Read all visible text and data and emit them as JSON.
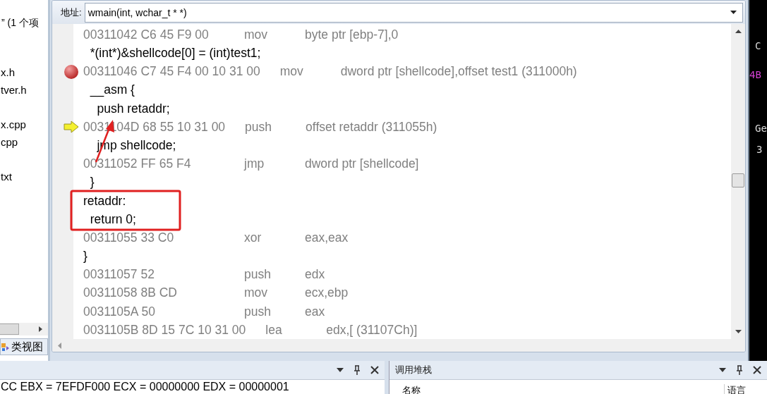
{
  "explorer": {
    "header": "” (1 个项",
    "items": [
      "x.h",
      "tver.h",
      "x.cpp",
      "cpp",
      "txt"
    ],
    "tab": "类视图"
  },
  "address_bar": {
    "label": "地址:",
    "value": "wmain(int, wchar_t * *)"
  },
  "disassembly": [
    {
      "kind": "asm",
      "breakpoint": false,
      "current": false,
      "bytes": "00311042 C6 45 F9 00",
      "mnemonic": "mov",
      "operand": "byte ptr [ebp-7],0"
    },
    {
      "kind": "src",
      "breakpoint": false,
      "current": false,
      "text": "  *(int*)&shellcode[0] = (int)test1;"
    },
    {
      "kind": "asm",
      "breakpoint": true,
      "current": false,
      "bytes": "00311046 C7 45 F4 00 10 31 00",
      "mnemonic": "mov",
      "operand": "dword ptr [shellcode],offset test1 (311000h)"
    },
    {
      "kind": "src",
      "breakpoint": false,
      "current": false,
      "text": "  __asm {"
    },
    {
      "kind": "src",
      "breakpoint": false,
      "current": false,
      "text": "    push retaddr;"
    },
    {
      "kind": "asm",
      "breakpoint": false,
      "current": true,
      "bytes": "0031104D 68 55 10 31 00",
      "mnemonic": "push",
      "operand": "offset retaddr (311055h)"
    },
    {
      "kind": "src",
      "breakpoint": false,
      "current": false,
      "text": "    jmp shellcode;"
    },
    {
      "kind": "asm",
      "breakpoint": false,
      "current": false,
      "bytes": "00311052 FF 65 F4",
      "mnemonic": "jmp",
      "operand": "dword ptr [shellcode]"
    },
    {
      "kind": "src",
      "breakpoint": false,
      "current": false,
      "text": "  }"
    },
    {
      "kind": "src",
      "breakpoint": false,
      "current": false,
      "text": "retaddr:"
    },
    {
      "kind": "src",
      "breakpoint": false,
      "current": false,
      "text": "  return 0;"
    },
    {
      "kind": "asm",
      "breakpoint": false,
      "current": false,
      "bytes": "00311055 33 C0",
      "mnemonic": "xor",
      "operand": "eax,eax"
    },
    {
      "kind": "src",
      "breakpoint": false,
      "current": false,
      "text": "}"
    },
    {
      "kind": "asm",
      "breakpoint": false,
      "current": false,
      "bytes": "00311057 52",
      "mnemonic": "push",
      "operand": "edx"
    },
    {
      "kind": "asm",
      "breakpoint": false,
      "current": false,
      "bytes": "00311058 8B CD",
      "mnemonic": "mov",
      "operand": "ecx,ebp"
    },
    {
      "kind": "asm",
      "breakpoint": false,
      "current": false,
      "bytes": "0031105A 50",
      "mnemonic": "push",
      "operand": "eax"
    },
    {
      "kind": "asm",
      "breakpoint": false,
      "current": false,
      "bytes": "0031105B 8D 15 7C 10 31 00",
      "mnemonic": "lea",
      "operand": "edx,[ (31107Ch)]"
    }
  ],
  "side_output": [
    "C",
    "4B",
    "Ge",
    "3"
  ],
  "registers_pane": {
    "text": "CC EBX = 7EFDF000 ECX = 00000000 EDX = 00000001"
  },
  "call_stack_pane": {
    "title": "调用堆栈",
    "columns": [
      "名称",
      "语言"
    ]
  }
}
